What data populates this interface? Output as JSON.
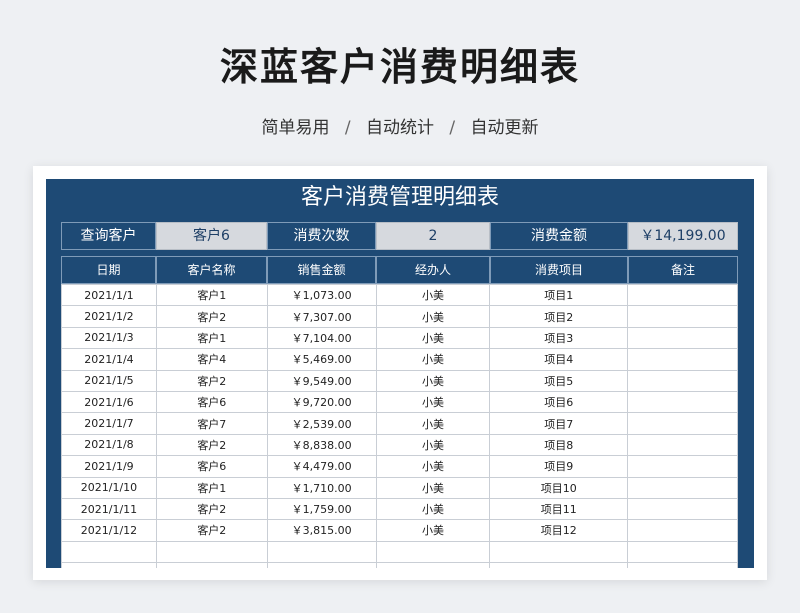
{
  "page": {
    "title": "深蓝客户消费明细表",
    "features": [
      "简单易用",
      "自动统计",
      "自动更新"
    ],
    "separator": "/"
  },
  "sheet": {
    "title": "客户消费管理明细表",
    "query": {
      "customer_label": "查询客户",
      "customer_value": "客户6",
      "count_label": "消费次数",
      "count_value": "2",
      "amount_label": "消费金额",
      "amount_value": "￥14,199.00"
    },
    "columns": [
      "日期",
      "客户名称",
      "销售金额",
      "经办人",
      "消费项目",
      "备注"
    ],
    "rows": [
      [
        "2021/1/1",
        "客户1",
        "￥1,073.00",
        "小美",
        "项目1",
        ""
      ],
      [
        "2021/1/2",
        "客户2",
        "￥7,307.00",
        "小美",
        "项目2",
        ""
      ],
      [
        "2021/1/3",
        "客户1",
        "￥7,104.00",
        "小美",
        "项目3",
        ""
      ],
      [
        "2021/1/4",
        "客户4",
        "￥5,469.00",
        "小美",
        "项目4",
        ""
      ],
      [
        "2021/1/5",
        "客户2",
        "￥9,549.00",
        "小美",
        "项目5",
        ""
      ],
      [
        "2021/1/6",
        "客户6",
        "￥9,720.00",
        "小美",
        "项目6",
        ""
      ],
      [
        "2021/1/7",
        "客户7",
        "￥2,539.00",
        "小美",
        "项目7",
        ""
      ],
      [
        "2021/1/8",
        "客户2",
        "￥8,838.00",
        "小美",
        "项目8",
        ""
      ],
      [
        "2021/1/9",
        "客户6",
        "￥4,479.00",
        "小美",
        "项目9",
        ""
      ],
      [
        "2021/1/10",
        "客户1",
        "￥1,710.00",
        "小美",
        "项目10",
        ""
      ],
      [
        "2021/1/11",
        "客户2",
        "￥1,759.00",
        "小美",
        "项目11",
        ""
      ],
      [
        "2021/1/12",
        "客户2",
        "￥3,815.00",
        "小美",
        "项目12",
        ""
      ],
      [
        "",
        "",
        "",
        "",
        "",
        ""
      ],
      [
        "",
        "",
        "",
        "",
        "",
        ""
      ]
    ]
  },
  "colors": {
    "header_blue": "#1e4a75",
    "query_value_bg": "#d6d9de",
    "page_bg": "#eef0f3"
  }
}
